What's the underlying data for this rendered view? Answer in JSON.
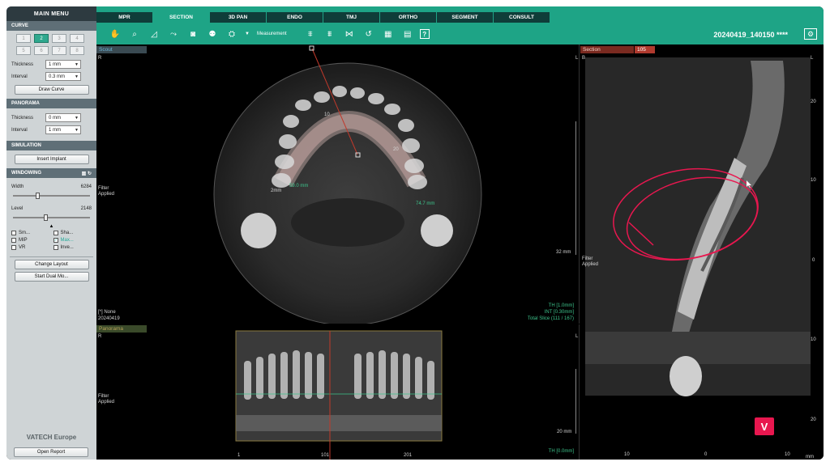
{
  "sidebar": {
    "main_menu": "MAIN MENU",
    "curve": {
      "title": "CURVE",
      "buttons": [
        "1",
        "2",
        "3",
        "4",
        "5",
        "6",
        "7",
        "8"
      ],
      "thickness_label": "Thickness",
      "thickness_value": "1 mm",
      "interval_label": "Interval",
      "interval_value": "0.3 mm",
      "draw_button": "Draw Curve"
    },
    "panorama": {
      "title": "PANORAMA",
      "thickness_label": "Thickness",
      "thickness_value": "0 mm",
      "interval_label": "Interval",
      "interval_value": "1 mm"
    },
    "simulation": {
      "title": "SIMULATION",
      "insert_button": "Insert Implant"
    },
    "windowing": {
      "title": "WINDOWING",
      "width_label": "Width",
      "width_value": "6284",
      "level_label": "Level",
      "level_value": "2148",
      "checks": [
        {
          "label": "Sm...",
          "checked": false
        },
        {
          "label": "Sha...",
          "checked": false
        },
        {
          "label": "MIP",
          "checked": false
        },
        {
          "label": "Max...",
          "checked": true
        },
        {
          "label": "VR",
          "checked": false
        },
        {
          "label": "Inve...",
          "checked": false
        }
      ]
    },
    "change_layout": "Change Layout",
    "start_dual": "Start Dual Mo...",
    "brand": "VATECH Europe",
    "open_report": "Open Report"
  },
  "tabs": [
    "MPR",
    "SECTION",
    "3D PAN",
    "ENDO",
    "TMJ",
    "ORTHO",
    "SEGMENT",
    "CONSULT"
  ],
  "active_tab": "SECTION",
  "toolbar": {
    "measurement": "Measurement",
    "help": "?",
    "study_id": "20240419_140150 ****"
  },
  "scout": {
    "title": "Scout",
    "r": "R",
    "l": "L",
    "filter": "Filter",
    "applied": "Applied",
    "none_line": "[*] None",
    "date_line": "20240419",
    "th": "TH [1.0mm]",
    "int": "INT [0.30mm]",
    "total": "Total Slice (111 / 167)",
    "scale": "32 mm",
    "meas1": "59.0 mm",
    "meas2": "74.7 mm",
    "arch_label_1": "2mm",
    "arch_label_2": "10",
    "arch_label_3": "20"
  },
  "panorama_view": {
    "title": "Panorama",
    "r": "R",
    "l": "L",
    "filter": "Filter",
    "applied": "Applied",
    "scale": "20 mm",
    "th": "TH [0.0mm]",
    "ticks": [
      "1",
      "101",
      "201"
    ]
  },
  "section_view": {
    "title": "Section",
    "number": "105",
    "b": "B",
    "l": "L",
    "filter": "Filter",
    "applied": "Applied",
    "right_ticks": [
      "20",
      "10",
      "0",
      "10",
      "20"
    ],
    "bottom_ticks": [
      "10",
      "0",
      "10"
    ],
    "unit": "mm"
  },
  "logo": "V"
}
